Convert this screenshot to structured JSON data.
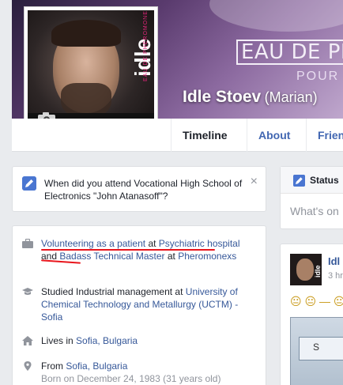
{
  "cover": {
    "brand_text": "EAU DE PH",
    "pour_text": "POUR H"
  },
  "profile": {
    "name": "Idle Stoev",
    "alternate_name": "(Marian)",
    "picture_text": "idle",
    "picture_subtext": "EAU DE PHEROMONE"
  },
  "tabs": [
    {
      "label": "Timeline"
    },
    {
      "label": "About"
    },
    {
      "label": "Frien"
    }
  ],
  "question": {
    "text": "When did you attend Vocational High School of Electronics \"John Atanasoff\"?",
    "close": "×"
  },
  "intro": {
    "work": {
      "link1": "Volunteering as a patient",
      "at1": " at ",
      "link2": "Psychiatric hospital",
      "and": " and ",
      "link3": "Badass Technical Master",
      "at2": " at ",
      "link4": "Pheromonexs"
    },
    "education": {
      "prefix": "Studied Industrial management at ",
      "link": "University of Chemical Technology and Metallurgy (UCTM) - Sofia"
    },
    "lives": {
      "prefix": "Lives in ",
      "link": "Sofia, Bulgaria"
    },
    "from": {
      "prefix": "From ",
      "link": "Sofia, Bulgaria",
      "born": "Born on December 24, 1983 (31 years old)"
    }
  },
  "status": {
    "label": "Status",
    "placeholder": "What's on"
  },
  "post": {
    "name": "Idl",
    "time": "3 hr",
    "emoji": "😐 😐 — 😐",
    "screenshot_letter": "S"
  },
  "colors": {
    "link": "#365899",
    "accent": "#4a76d1",
    "underline": "#e8151c"
  }
}
